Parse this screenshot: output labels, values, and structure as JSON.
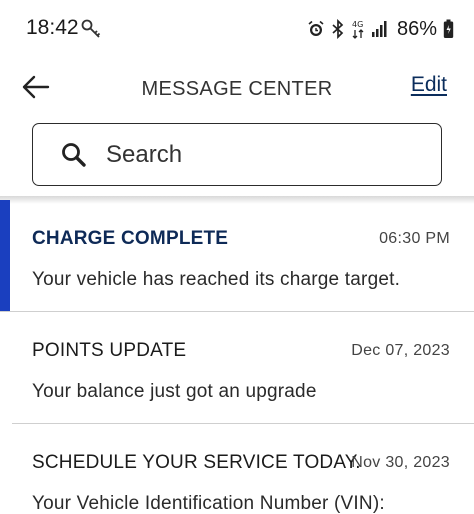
{
  "status_bar": {
    "time": "18:42",
    "battery": "86%",
    "icons": [
      "key-icon",
      "alarm-icon",
      "bluetooth-icon",
      "wifi-data-icon",
      "signal-icon",
      "battery-icon"
    ]
  },
  "header": {
    "title": "MESSAGE CENTER",
    "edit_label": "Edit",
    "back_icon": "arrow-left-icon"
  },
  "search": {
    "placeholder": "Search",
    "icon": "search-icon"
  },
  "colors": {
    "brand_blue": "#0b2d5c",
    "unread_indicator": "#1a3fbf"
  },
  "messages": [
    {
      "title": "CHARGE COMPLETE",
      "date": "06:30 PM",
      "body": "Your vehicle has reached its charge target.",
      "unread": true
    },
    {
      "title": "POINTS UPDATE",
      "date": "Dec 07, 2023",
      "body": "Your balance just got an upgrade",
      "unread": false
    },
    {
      "title": "SCHEDULE YOUR SERVICE TODAY.",
      "date": "Nov 30, 2023",
      "body": "Your Vehicle Identification Number (VIN):",
      "unread": false
    }
  ]
}
